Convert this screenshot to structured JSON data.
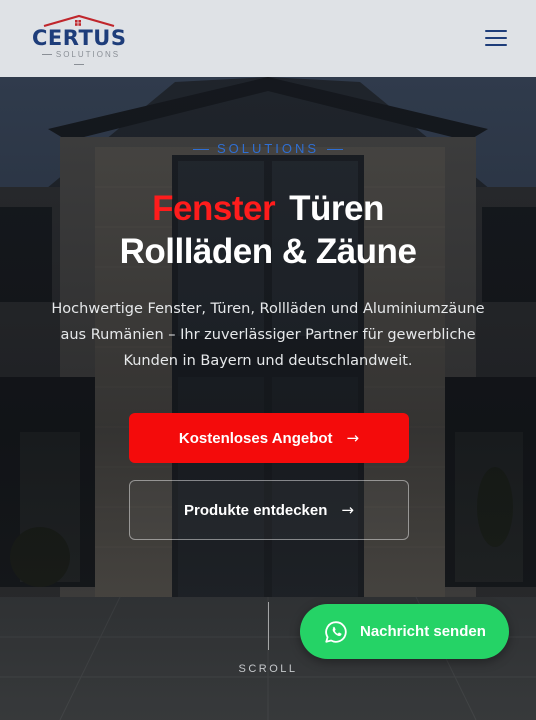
{
  "header": {
    "logo_text": "CERTUS",
    "logo_subtext": "SOLUTIONS",
    "menu_icon": "hamburger-menu-icon"
  },
  "hero": {
    "eyebrow": "SOLUTIONS",
    "headline_accent": "Fenster",
    "headline_rest": "Türen",
    "headline_line2": "Rollläden & Zäune",
    "lead": "Hochwertige Fenster, Türen, Rollläden und Aluminiumzäune aus Rumänien – Ihr zuverlässiger Partner für gewerbliche Kunden in Bayern und deutschlandweit.",
    "primary_cta": "Kostenloses Angebot",
    "secondary_cta": "Produkte entdecken",
    "scroll_label": "SCROLL"
  },
  "whatsapp": {
    "label": "Nachricht senden",
    "icon": "whatsapp-icon"
  },
  "colors": {
    "brand_blue": "#1e3d7a",
    "accent_red": "#f40b0b",
    "whatsapp_green": "#25d366",
    "eyebrow_blue": "#2f6fd3"
  }
}
